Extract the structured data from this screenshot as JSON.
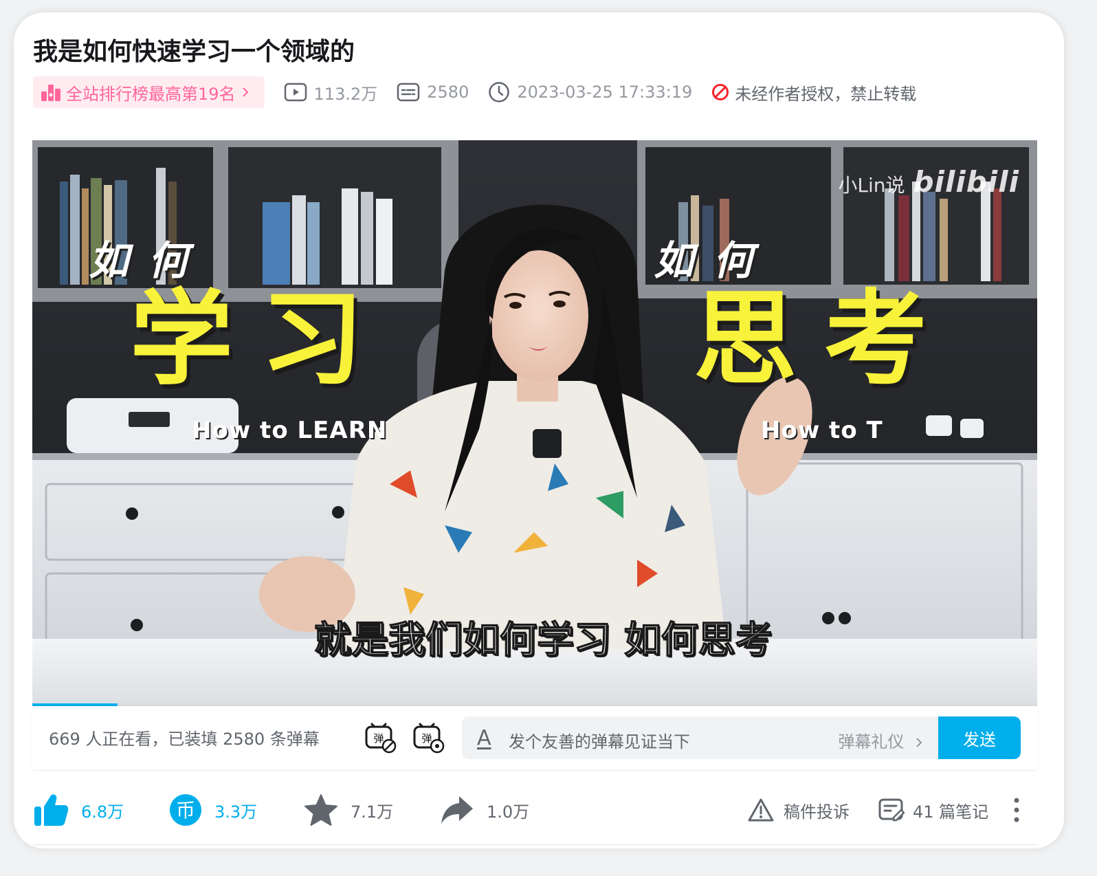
{
  "video": {
    "title": "我是如何快速学习一个领域的",
    "rank_badge": "全站排行榜最高第19名",
    "views": "113.2万",
    "danmaku_count": "2580",
    "publish_time": "2023-03-25 17:33:19",
    "copyright": "未经作者授权，禁止转载",
    "progress": 0.085
  },
  "frame": {
    "watermark_author": "小Lin说",
    "watermark_brand": "bilibili",
    "left_small": "如 何",
    "left_big": "学习",
    "left_english": "How to LEARN",
    "right_small": "如 何",
    "right_big": "思考",
    "right_english": "How to T",
    "subtitle": "就是我们如何学习 如何思考"
  },
  "danmaku": {
    "viewer_info": "669 人正在看，已装填 2580 条弹幕",
    "font_glyph": "A",
    "placeholder": "发个友善的弹幕见证当下",
    "etiquette": "弹幕礼仪",
    "send": "发送"
  },
  "actions": {
    "like": "6.8万",
    "coin": "3.3万",
    "favorite": "7.1万",
    "share": "1.0万",
    "report": "稿件投诉",
    "notes": "41 篇笔记"
  },
  "colors": {
    "accent": "#00aeec",
    "pink": "#ff6699",
    "warn_red": "#f5222d",
    "caption_yellow": "#f8f23a"
  },
  "icons": [
    "rank-icon",
    "play-count-icon",
    "danmaku-count-icon",
    "clock-icon",
    "forbidden-icon",
    "danmaku-toggle-icon",
    "danmaku-settings-icon",
    "font-icon",
    "chevron-right-icon",
    "thumbs-up-icon",
    "coin-icon",
    "star-icon",
    "share-icon",
    "warning-icon",
    "notes-icon",
    "more-vertical-icon"
  ]
}
